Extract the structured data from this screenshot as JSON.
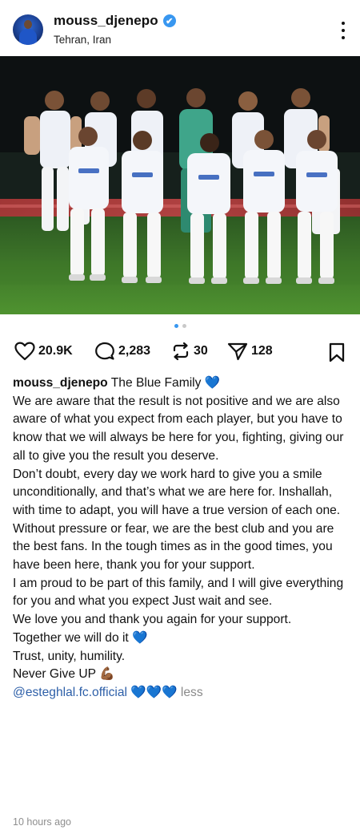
{
  "header": {
    "username": "mouss_djenepo",
    "location": "Tehran, Iran",
    "verified_icon": "✔"
  },
  "carousel": {
    "count": 2,
    "active": 0
  },
  "actions": {
    "likes": "20.9K",
    "comments": "2,283",
    "reposts": "30",
    "shares": "128"
  },
  "caption": {
    "username": "mouss_djenepo",
    "title": "The Blue Family 💙",
    "paragraphs": [
      "We are aware that the result is not positive and we are also aware of what you expect from each player, but you have to know that we will always be here for you, fighting, giving our all to give you the result you deserve.",
      "Don’t doubt, every day we work hard to give you a smile unconditionally, and that’s what we are here for. Inshallah, with time to adapt, you will have a true version of each one.",
      "Without pressure or fear, we are the best club and you are the best fans. In the tough times as in the good times, you have been here, thank you for your support.",
      "I am proud to be part of this family, and I will give everything for you and what you expect Just wait and see.",
      "We love you and thank you again for your support.",
      "Together we will do it 💙",
      "Trust, unity, humility.",
      "Never Give UP 💪🏾"
    ],
    "mention": "@esteghlal.fc.official",
    "mention_emojis": "💙💙💙",
    "less_label": "less"
  },
  "timestamp": "10 hours ago",
  "colors": {
    "accent": "#3897f0",
    "mention": "#2d5fa8",
    "muted": "#8e8e8e",
    "kit": "#eef1f7",
    "keeper": "#3fa58a"
  }
}
